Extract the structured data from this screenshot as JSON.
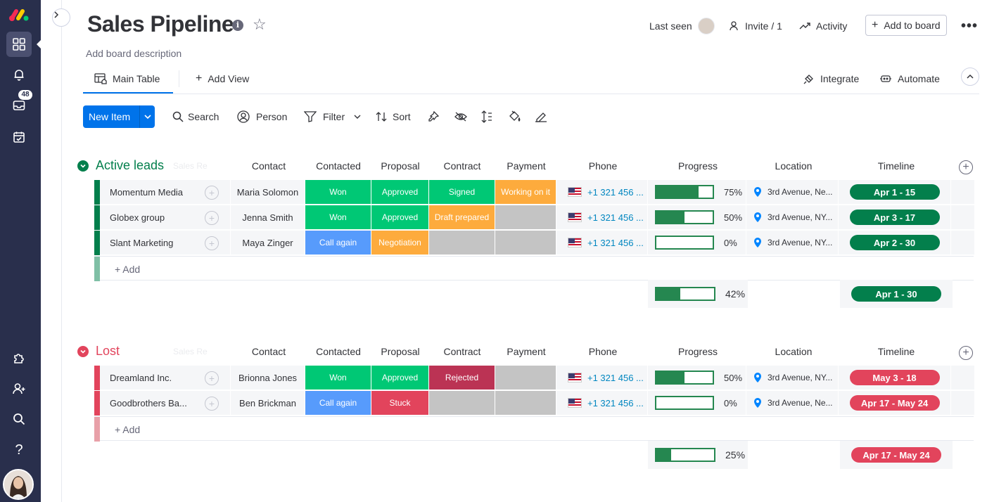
{
  "app": {
    "title": "Sales Pipeline",
    "description": "Add board description",
    "notification_count": "48"
  },
  "header": {
    "last_seen": "Last seen",
    "invite": "Invite / 1",
    "activity": "Activity",
    "add_to_board": "Add to board",
    "more": "•••"
  },
  "views": {
    "main_table": "Main Table",
    "add_view": "Add View",
    "integrate": "Integrate",
    "automate": "Automate"
  },
  "toolbar": {
    "new_item": "New Item",
    "search": "Search",
    "person": "Person",
    "filter": "Filter",
    "sort": "Sort"
  },
  "columns": {
    "contact": "Contact",
    "contacted": "Contacted",
    "proposal": "Proposal",
    "contract": "Contract",
    "payment": "Payment",
    "phone": "Phone",
    "progress": "Progress",
    "location": "Location",
    "timeline": "Timeline",
    "ghost": "Sales Re"
  },
  "colors": {
    "green": "#00c875",
    "blue": "#579bfc",
    "orange": "#fdab3d",
    "grey": "#c4c4c4",
    "red_dark": "#bb3354",
    "stuck": "#e2445c",
    "group_active": "#037f4c",
    "group_lost": "#e2445c",
    "timeline_active": "#037f4c",
    "timeline_lost": "#e2445c"
  },
  "groups": [
    {
      "name": "Active leads",
      "add_label": "+ Add",
      "summary_progress": "42%",
      "summary_progress_value": 0.42,
      "summary_timeline": "Apr 1 - 30",
      "rows": [
        {
          "name": "Momentum Media",
          "contact": "Maria Solomon",
          "contacted": {
            "t": "Won",
            "c": "green"
          },
          "proposal": {
            "t": "Approved",
            "c": "green"
          },
          "contract": {
            "t": "Signed",
            "c": "green"
          },
          "payment": {
            "t": "Working on it",
            "c": "orange"
          },
          "phone": "+1 321 456 ...",
          "progress": "75%",
          "progress_value": 0.75,
          "location": "3rd Avenue, Ne...",
          "timeline": "Apr 1 - 15"
        },
        {
          "name": "Globex group",
          "contact": "Jenna Smith",
          "contacted": {
            "t": "Won",
            "c": "green"
          },
          "proposal": {
            "t": "Approved",
            "c": "green"
          },
          "contract": {
            "t": "Draft prepared",
            "c": "orange"
          },
          "payment": {
            "t": "",
            "c": "grey"
          },
          "phone": "+1 321 456 ...",
          "progress": "50%",
          "progress_value": 0.5,
          "location": "3rd Avenue, NY...",
          "timeline": "Apr 3 - 17"
        },
        {
          "name": "Slant Marketing",
          "contact": "Maya Zinger",
          "contacted": {
            "t": "Call again",
            "c": "blue"
          },
          "proposal": {
            "t": "Negotiation",
            "c": "orange"
          },
          "contract": {
            "t": "",
            "c": "grey"
          },
          "payment": {
            "t": "",
            "c": "grey"
          },
          "phone": "+1 321 456 ...",
          "progress": "0%",
          "progress_value": 0,
          "location": "3rd Avenue, NY...",
          "timeline": "Apr 2 - 30"
        }
      ]
    },
    {
      "name": "Lost",
      "add_label": "+ Add",
      "summary_progress": "25%",
      "summary_progress_value": 0.25,
      "summary_timeline": "Apr 17 - May 24",
      "rows": [
        {
          "name": "Dreamland Inc.",
          "contact": "Brionna Jones",
          "contacted": {
            "t": "Won",
            "c": "green"
          },
          "proposal": {
            "t": "Approved",
            "c": "green"
          },
          "contract": {
            "t": "Rejected",
            "c": "red_dark"
          },
          "payment": {
            "t": "",
            "c": "grey"
          },
          "phone": "+1 321 456 ...",
          "progress": "50%",
          "progress_value": 0.5,
          "location": "3rd Avenue, NY...",
          "timeline": "May 3 - 18"
        },
        {
          "name": "Goodbrothers Ba...",
          "contact": "Ben Brickman",
          "contacted": {
            "t": "Call again",
            "c": "blue"
          },
          "proposal": {
            "t": "Stuck",
            "c": "stuck"
          },
          "contract": {
            "t": "",
            "c": "grey"
          },
          "payment": {
            "t": "",
            "c": "grey"
          },
          "phone": "+1 321 456 ...",
          "progress": "0%",
          "progress_value": 0,
          "location": "3rd Avenue, Ne...",
          "timeline": "Apr 17 - May 24"
        }
      ]
    }
  ]
}
